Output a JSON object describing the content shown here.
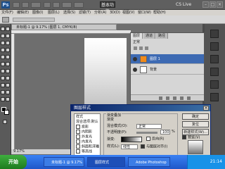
{
  "app": {
    "logo": "Ps",
    "basic_button": "基本功能",
    "cs_live": "CS Live"
  },
  "menu": [
    "文件(F)",
    "编辑(E)",
    "图像(I)",
    "图层(L)",
    "选择(S)",
    "滤镜(T)",
    "分析(A)",
    "3D(D)",
    "视图(V)",
    "窗口(W)",
    "帮助(H)"
  ],
  "document": {
    "tab_title": "未标题-1 @ 9.17% (图层 1, CMYK/8)",
    "status": "9.17%"
  },
  "layers_panel": {
    "tabs": [
      "图层",
      "通道",
      "路径"
    ],
    "options_label": "正常",
    "layers": [
      {
        "name": "图层 1",
        "selected": true
      },
      {
        "name": "背景",
        "selected": false
      }
    ]
  },
  "dialog": {
    "title": "图层样式",
    "style_list": [
      "样式",
      "混合选项:默认",
      "投影",
      "内阴影",
      "外发光",
      "内发光",
      "斜面和浮雕",
      "等高线"
    ],
    "group_title": "渐变叠加",
    "subgroup": "渐变",
    "blend_mode_label": "混合模式(O):",
    "blend_mode_value": "正常",
    "opacity_label": "不透明度(P):",
    "opacity_value": "100",
    "opacity_unit": "%",
    "gradient_label": "渐变:",
    "reverse_label": "反向(R)",
    "style_label": "样式(L):",
    "style_value": "线性",
    "align_label": "与图层对齐(I)",
    "buttons": [
      "确定",
      "复位",
      "新建样式(W)...",
      "预览(V)"
    ]
  },
  "taskbar": {
    "start": "开始",
    "tasks": [
      "未标题-1 @ 9.17%",
      "图层样式",
      "Adobe Photoshop"
    ],
    "time": "21:14"
  },
  "colors": {
    "title_bar": "#0a246a",
    "taskbar": "#2a6ee0",
    "start": "#2f9a2f"
  }
}
